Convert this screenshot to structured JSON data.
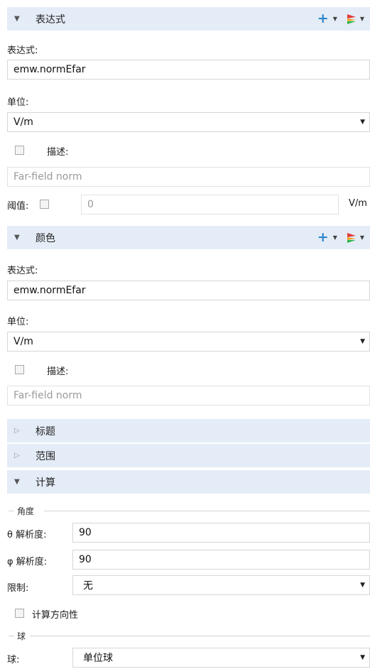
{
  "expression_section": {
    "title": "表达式",
    "expr_label": "表达式:",
    "expr_value": "emw.normEfar",
    "unit_label": "单位:",
    "unit_value": "V/m",
    "desc_label": "描述:",
    "desc_value": "Far-field norm",
    "threshold_label": "阈值:",
    "threshold_value": "0",
    "threshold_unit": "V/m"
  },
  "color_section": {
    "title": "颜色",
    "expr_label": "表达式:",
    "expr_value": "emw.normEfar",
    "unit_label": "单位:",
    "unit_value": "V/m",
    "desc_label": "描述:",
    "desc_value": "Far-field norm"
  },
  "title_section": {
    "title": "标题"
  },
  "range_section": {
    "title": "范围"
  },
  "compute_section": {
    "title": "计算",
    "angle_group": "角度",
    "theta_label": "θ 解析度:",
    "theta_value": "90",
    "phi_label": "φ 解析度:",
    "phi_value": "90",
    "limit_label": "限制:",
    "limit_value": "无",
    "directivity_label": "计算方向性",
    "sphere_group": "球",
    "sphere_label": "球:",
    "sphere_value": "单位球"
  },
  "icons": {
    "expanded": "triangle-down-icon",
    "collapsed": "triangle-right-icon",
    "add": "plus-icon",
    "plot": "plot-icon",
    "dropdown": "chevron-down-icon"
  },
  "colors": {
    "section_header_bg": "#e4ecf7",
    "plus_blue": "#2f86c8"
  }
}
